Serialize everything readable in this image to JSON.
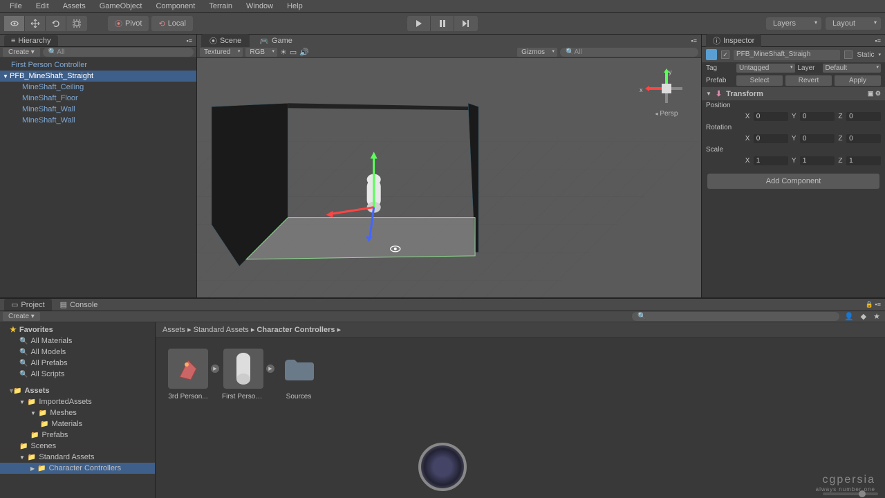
{
  "menu": {
    "items": [
      "File",
      "Edit",
      "Assets",
      "GameObject",
      "Component",
      "Terrain",
      "Window",
      "Help"
    ]
  },
  "toolbar": {
    "pivot": "Pivot",
    "local": "Local",
    "layers": "Layers",
    "layout": "Layout"
  },
  "hierarchy": {
    "title": "Hierarchy",
    "create": "Create",
    "search_placeholder": "All",
    "items": [
      {
        "name": "First Person Controller",
        "selected": false,
        "child": false,
        "arrow": ""
      },
      {
        "name": "PFB_MineShaft_Straight",
        "selected": true,
        "child": false,
        "arrow": "▼"
      },
      {
        "name": "MineShaft_Ceiling",
        "selected": false,
        "child": true,
        "arrow": ""
      },
      {
        "name": "MineShaft_Floor",
        "selected": false,
        "child": true,
        "arrow": ""
      },
      {
        "name": "MineShaft_Wall",
        "selected": false,
        "child": true,
        "arrow": ""
      },
      {
        "name": "MineShaft_Wall",
        "selected": false,
        "child": true,
        "arrow": ""
      }
    ]
  },
  "scene": {
    "tab_scene": "Scene",
    "tab_game": "Game",
    "textured": "Textured",
    "rgb": "RGB",
    "gizmos": "Gizmos",
    "search_placeholder": "All",
    "persp": "Persp",
    "axis_x": "x",
    "axis_y": "y"
  },
  "inspector": {
    "title": "Inspector",
    "name": "PFB_MineShaft_Straigh",
    "static": "Static",
    "tag": "Tag",
    "tag_value": "Untagged",
    "layer": "Layer",
    "layer_value": "Default",
    "prefab": "Prefab",
    "select": "Select",
    "revert": "Revert",
    "apply": "Apply",
    "transform": "Transform",
    "position": "Position",
    "rotation": "Rotation",
    "scale": "Scale",
    "pos": {
      "x": "0",
      "y": "0",
      "z": "0"
    },
    "rot": {
      "x": "0",
      "y": "0",
      "z": "0"
    },
    "scl": {
      "x": "1",
      "y": "1",
      "z": "1"
    },
    "add_component": "Add Component"
  },
  "project": {
    "tab_project": "Project",
    "tab_console": "Console",
    "create": "Create",
    "favorites": "Favorites",
    "fav_items": [
      "All Materials",
      "All Models",
      "All Prefabs",
      "All Scripts"
    ],
    "assets": "Assets",
    "tree": [
      {
        "name": "ImportedAssets",
        "level": 1,
        "arrow": "▼"
      },
      {
        "name": "Meshes",
        "level": 2,
        "arrow": "▼"
      },
      {
        "name": "Materials",
        "level": 3,
        "arrow": ""
      },
      {
        "name": "Prefabs",
        "level": 2,
        "arrow": ""
      },
      {
        "name": "Scenes",
        "level": 1,
        "arrow": ""
      },
      {
        "name": "Standard Assets",
        "level": 1,
        "arrow": "▼"
      },
      {
        "name": "Character Controllers",
        "level": 2,
        "arrow": "▶",
        "selected": true
      }
    ],
    "breadcrumb": [
      "Assets",
      "Standard Assets",
      "Character Controllers"
    ],
    "grid": [
      {
        "name": "3rd Person...",
        "type": "prefab",
        "play": true
      },
      {
        "name": "First Person...",
        "type": "capsule",
        "play": true
      },
      {
        "name": "Sources",
        "type": "folder",
        "play": false
      }
    ]
  },
  "watermark": {
    "main": "cgpersia",
    "sub": "always number one"
  }
}
